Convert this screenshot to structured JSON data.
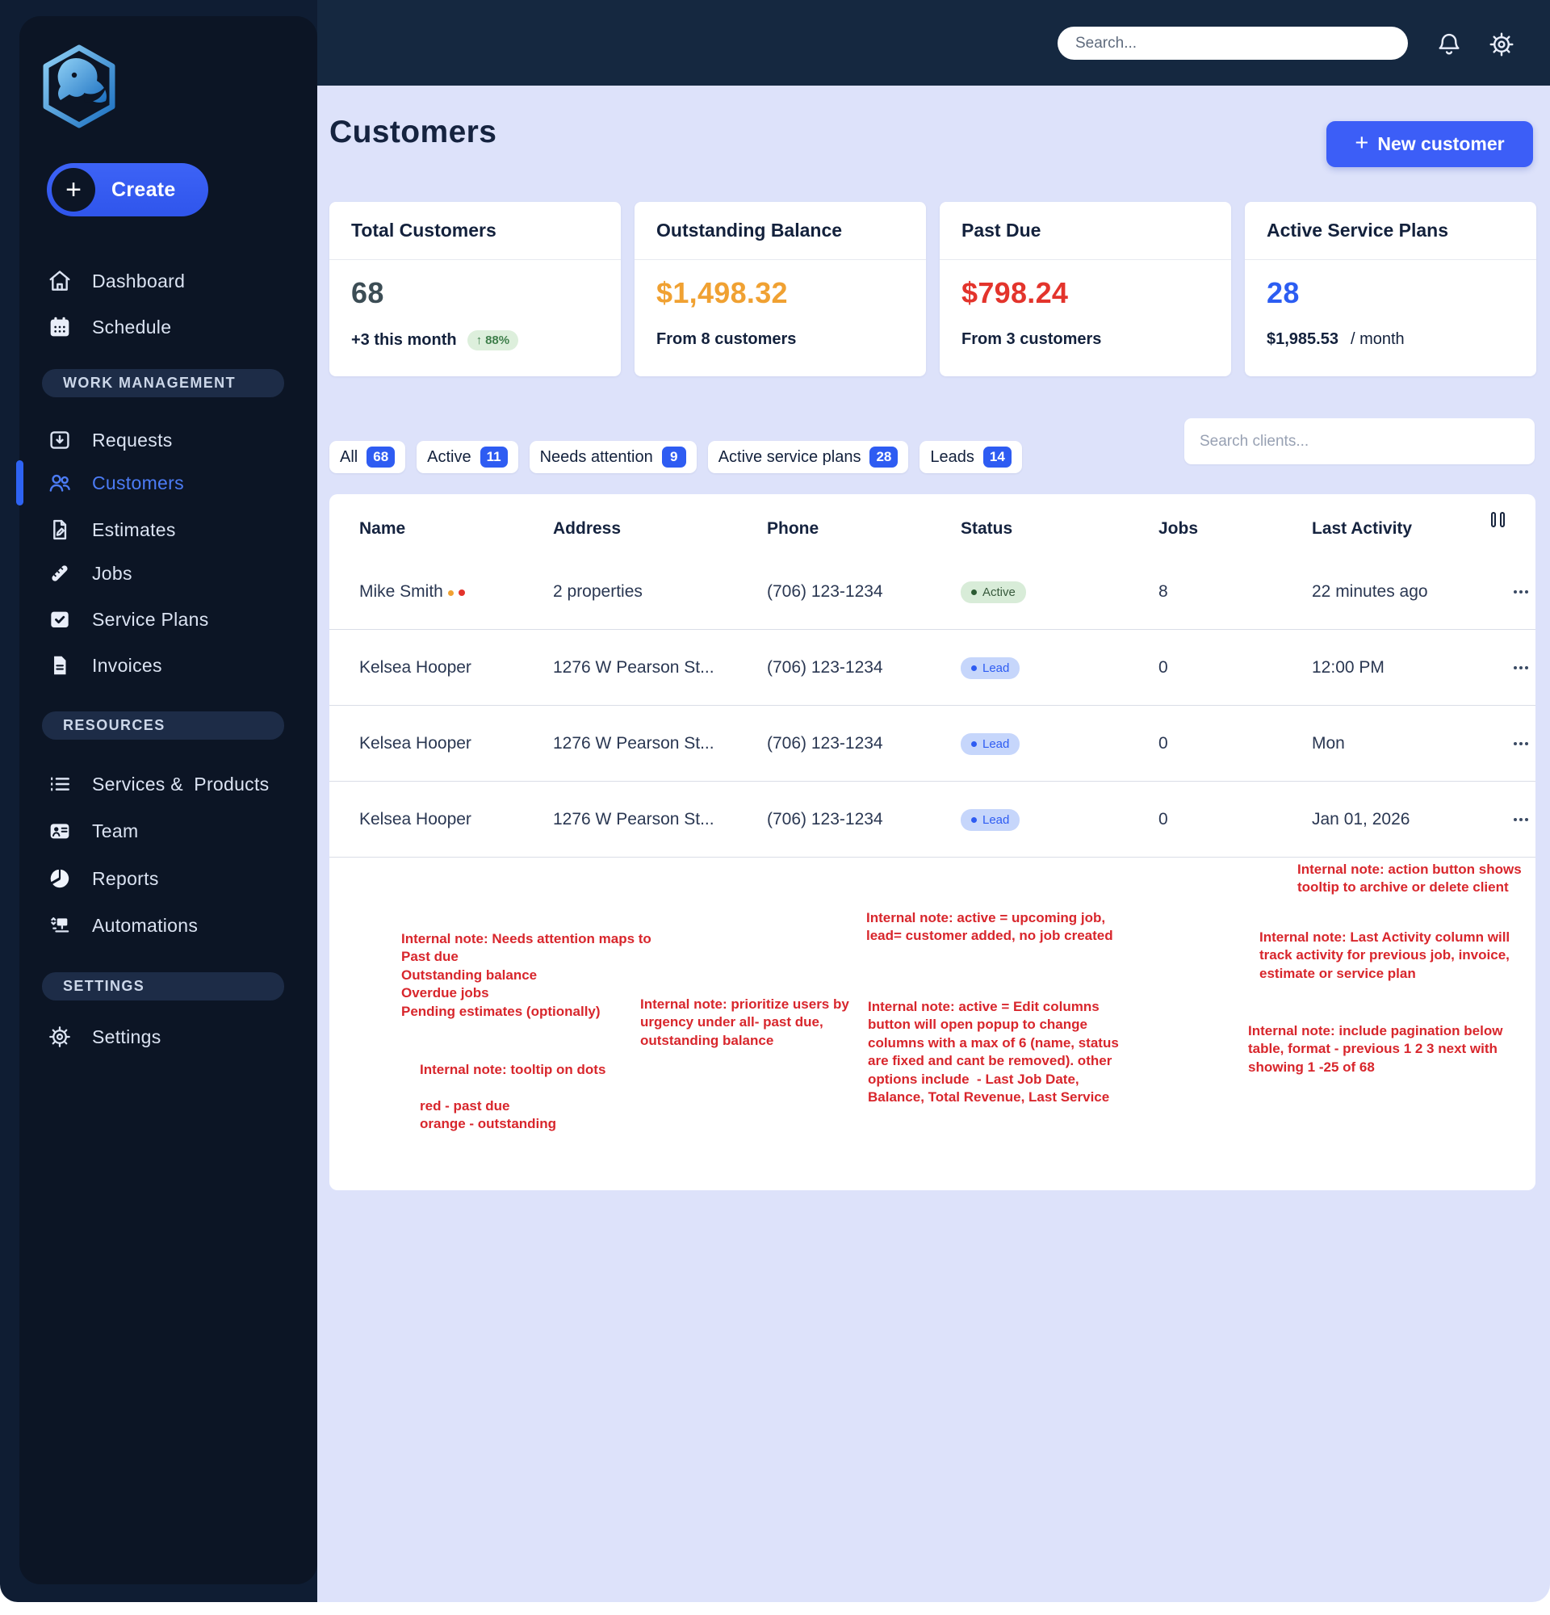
{
  "colors": {
    "accent_blue": "#2e5cf2",
    "sidebar_active_blue": "#4c7cf6",
    "orange": "#f0a132",
    "red": "#e3342c",
    "green_text": "#3f7f4b",
    "green_bg": "#ddefdc",
    "note_red": "#d8262c",
    "active_badge_bg": "#d8ecd8",
    "lead_badge_bg": "#c6d6fb",
    "topbar_bg": "#152840",
    "sidebar_bg": "#0c1525",
    "content_bg": "#dde2fa"
  },
  "icons": {
    "logo": "rhino-in-hexagon",
    "bell-icon": "bell outline",
    "gear-icon": "gear outline",
    "columns-icon": "two vertical bars",
    "up-arrow": "↑",
    "ellipsis": "three dots"
  },
  "topbar": {
    "search_placeholder": "Search..."
  },
  "sidebar": {
    "create": {
      "label": "Create",
      "plus": "+"
    },
    "nav_top": [
      {
        "label": "Dashboard"
      },
      {
        "label": "Schedule"
      }
    ],
    "sections": [
      {
        "header": "WORK MANAGEMENT",
        "items": [
          {
            "label": "Requests"
          },
          {
            "label": "Customers"
          },
          {
            "label": "Estimates"
          },
          {
            "label": "Jobs"
          },
          {
            "label": "Service Plans"
          },
          {
            "label": "Invoices"
          }
        ]
      },
      {
        "header": "RESOURCES",
        "items": [
          {
            "label": "Services &  Products"
          },
          {
            "label": "Team"
          },
          {
            "label": "Reports"
          },
          {
            "label": "Automations"
          }
        ]
      },
      {
        "header": "SETTINGS",
        "items": [
          {
            "label": "Settings"
          }
        ]
      }
    ]
  },
  "header": {
    "title": "Customers",
    "new_customer": {
      "label": "New customer",
      "plus": "+"
    }
  },
  "stats": {
    "cards": [
      {
        "title": "Total Customers",
        "value": "68",
        "subtitle": "+3 this month",
        "badge_arrow": "↑",
        "badge": "88%"
      },
      {
        "title": "Outstanding Balance",
        "value": "$1,498.32",
        "subtitle": "From 8 customers"
      },
      {
        "title": "Past Due",
        "value": "$798.24",
        "subtitle": "From 3 customers"
      },
      {
        "title": "Active Service Plans",
        "value": "28",
        "subtitle": "$1,985.53",
        "suffix": "/ month"
      }
    ]
  },
  "filters": {
    "chips": [
      {
        "label": "All",
        "count": "68"
      },
      {
        "label": "Active",
        "count": "11"
      },
      {
        "label": "Needs attention",
        "count": "9"
      },
      {
        "label": "Active service plans",
        "count": "28"
      },
      {
        "label": "Leads",
        "count": "14"
      }
    ],
    "search_placeholder": "Search clients..."
  },
  "table": {
    "columns": [
      "Name",
      "Address",
      "Phone",
      "Status",
      "Jobs",
      "Last Activity"
    ],
    "rows": [
      {
        "name": "Mike Smith",
        "address": "2 properties",
        "phone": "(706) 123-1234",
        "status": "Active",
        "jobs": "8",
        "last_activity": "22 minutes ago"
      },
      {
        "name": "Kelsea Hooper",
        "address": "1276 W Pearson St...",
        "phone": "(706) 123-1234",
        "status": "Lead",
        "jobs": "0",
        "last_activity": "12:00 PM"
      },
      {
        "name": "Kelsea Hooper",
        "address": "1276 W Pearson St...",
        "phone": "(706) 123-1234",
        "status": "Lead",
        "jobs": "0",
        "last_activity": "Mon"
      },
      {
        "name": "Kelsea Hooper",
        "address": "1276 W Pearson St...",
        "phone": "(706) 123-1234",
        "status": "Lead",
        "jobs": "0",
        "last_activity": "Jan 01, 2026"
      }
    ]
  },
  "notes": {
    "archive": "Internal note: action button shows\ntooltip to archive or delete client",
    "needs_attention": "Internal note: Needs attention maps to\nPast due\nOutstanding balance\nOverdue jobs\nPending estimates (optionally)",
    "status_meaning": "Internal note: active = upcoming job,\nlead= customer added, no job created",
    "last_activity": "Internal note: Last Activity column will\ntrack activity for previous job, invoice,\nestimate or service plan",
    "prioritize": "Internal note: prioritize users by\nurgency under all- past due,\noutstanding balance",
    "edit_columns": "Internal note: active = Edit columns\nbutton will open popup to change\ncolumns with a max of 6 (name, status\nare fixed and cant be removed). other\noptions include  - Last Job Date,\nBalance, Total Revenue, Last Service",
    "pagination": "Internal note: include pagination below\ntable, format - previous 1 2 3 next with\nshowing 1 -25 of 68",
    "dots_tooltip": "Internal note: tooltip on dots\n\nred - past due\norange - outstanding"
  }
}
